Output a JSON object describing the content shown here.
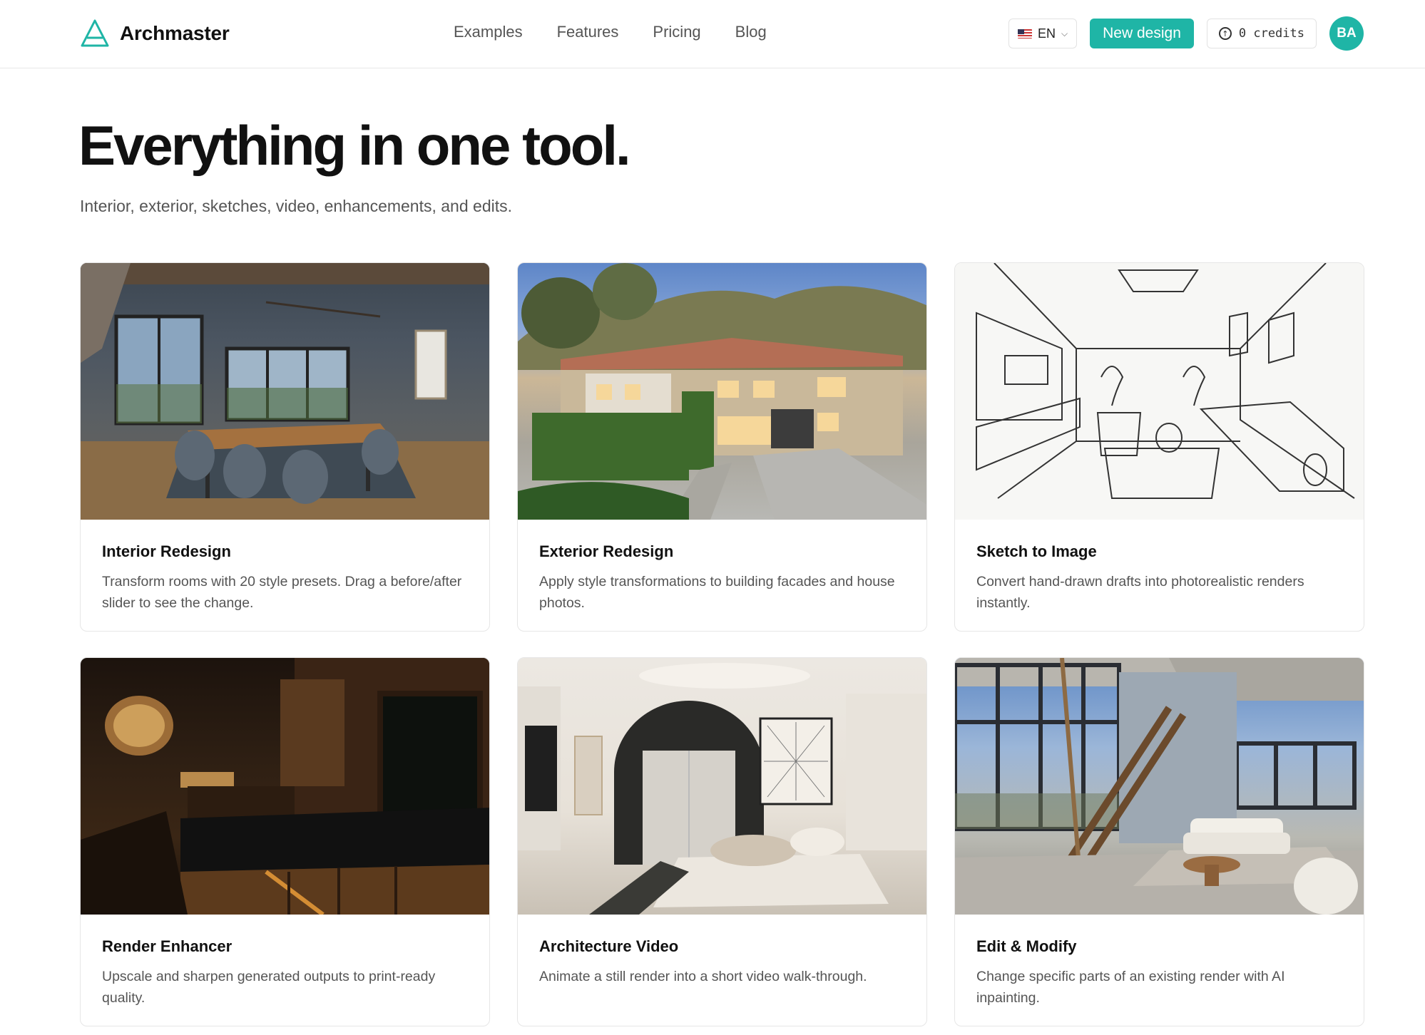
{
  "header": {
    "brand_name": "Archmaster",
    "nav": [
      "Examples",
      "Features",
      "Pricing",
      "Blog"
    ],
    "language": "EN",
    "new_design_label": "New design",
    "credits_label": "0 credits",
    "avatar_initials": "BA",
    "accent_color": "#1fb5a6"
  },
  "hero": {
    "title": "Everything in one tool.",
    "subtitle": "Interior, exterior, sketches, video, enhancements, and edits."
  },
  "cards": [
    {
      "title": "Interior Redesign",
      "description": "Transform rooms with 20 style presets. Drag a before/after slider to see the change."
    },
    {
      "title": "Exterior Redesign",
      "description": "Apply style transformations to building facades and house photos."
    },
    {
      "title": "Sketch to Image",
      "description": "Convert hand-drawn drafts into photorealistic renders instantly."
    },
    {
      "title": "Render Enhancer",
      "description": "Upscale and sharpen generated outputs to print-ready quality."
    },
    {
      "title": "Architecture Video",
      "description": "Animate a still render into a short video walk-through."
    },
    {
      "title": "Edit & Modify",
      "description": "Change specific parts of an existing render with AI inpainting."
    }
  ]
}
